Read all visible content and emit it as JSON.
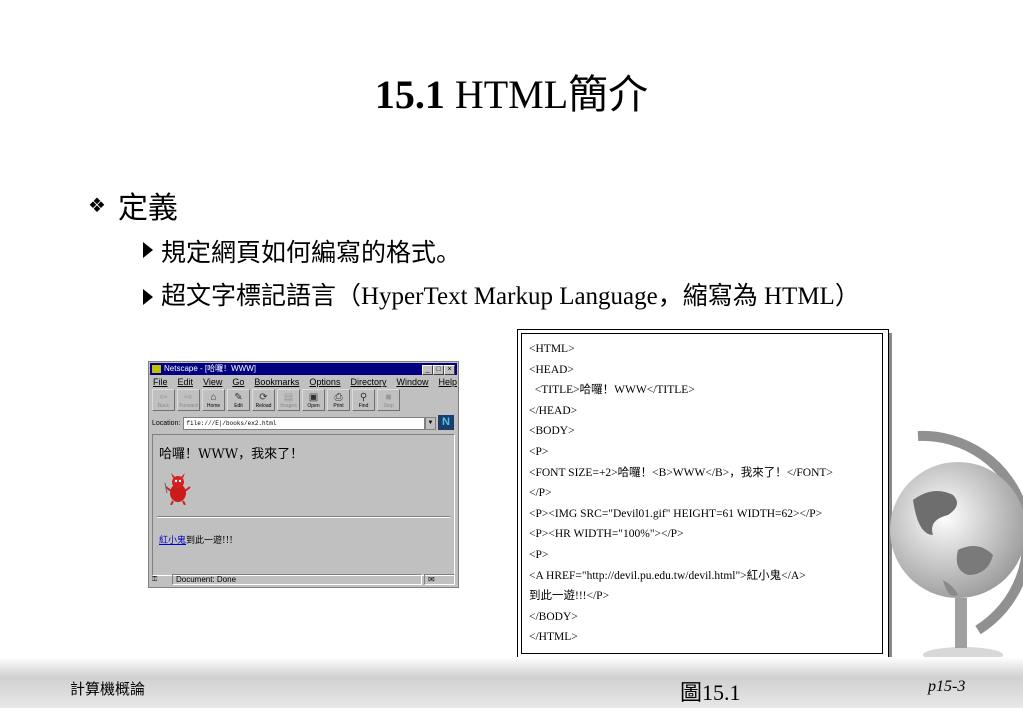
{
  "slide": {
    "title_num": "15.1",
    "title_text": "HTML簡介",
    "bullet1": "定義",
    "bullet2": "規定網頁如何編寫的格式。",
    "bullet3": "超文字標記語言（HyperText Markup Language，縮寫為 HTML）"
  },
  "browser": {
    "title": "Netscape - [哈囉！WWW]",
    "menu": [
      "File",
      "Edit",
      "View",
      "Go",
      "Bookmarks",
      "Options",
      "Directory",
      "Window",
      "Help"
    ],
    "toolbar": [
      "Back",
      "Forward",
      "Home",
      "Edit",
      "Reload",
      "Images",
      "Open",
      "Print",
      "Find",
      "Stop"
    ],
    "location_label": "Location:",
    "location_value": "file:///E|/books/ex2.html",
    "page_heading": "哈囉！WWW，我來了！",
    "link_text": "紅小鬼",
    "after_link": "到此一遊!!!",
    "status": "Document: Done"
  },
  "code": {
    "lines": [
      "<HTML>",
      "<HEAD>",
      "  <TITLE>哈囉！WWW</TITLE>",
      "</HEAD>",
      "<BODY>",
      "<P>",
      "<FONT SIZE=+2>哈囉！<B>WWW</B>，我來了！</FONT>",
      "</P>",
      "<P><IMG SRC=\"Devil01.gif\" HEIGHT=61 WIDTH=62></P>",
      "<P><HR WIDTH=\"100%\"></P>",
      "<P>",
      "<A HREF=\"http://devil.pu.edu.tw/devil.html\">紅小鬼</A>",
      "到此一遊!!!</P>",
      "</BODY>",
      "</HTML>"
    ]
  },
  "footer": {
    "left": "計算機概論",
    "center": "圖15.1",
    "right": "p15-3"
  },
  "colors": {
    "titlebar": "#000080",
    "window": "#c0c0c0",
    "link": "#0000cc"
  }
}
